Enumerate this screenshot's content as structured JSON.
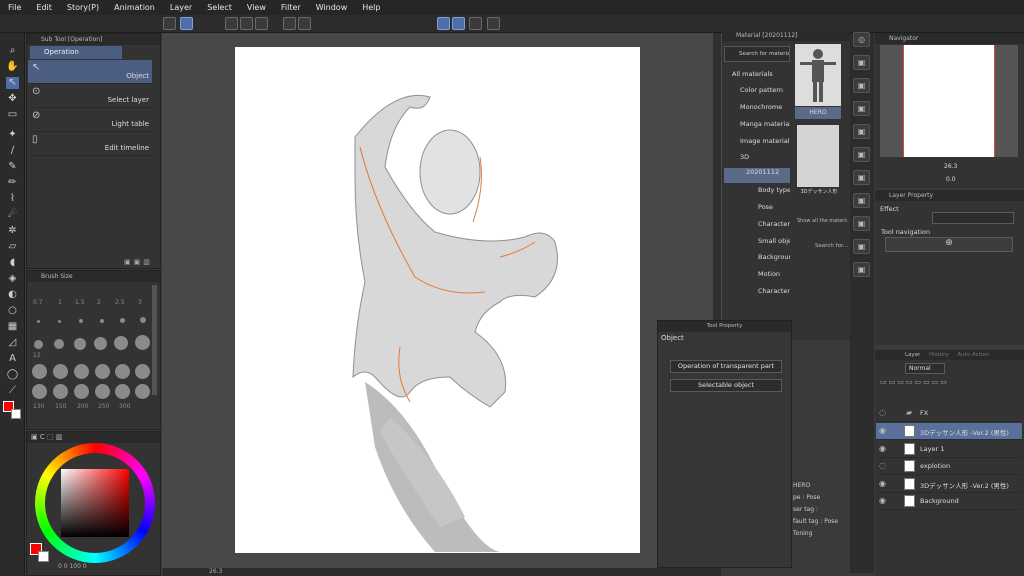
{
  "menu": [
    "File",
    "Edit",
    "Story(P)",
    "Animation",
    "Layer",
    "Select",
    "View",
    "Filter",
    "Window",
    "Help"
  ],
  "subtool": {
    "header": "Sub Tool [Operation]",
    "tab": "Operation",
    "items": [
      "Object",
      "Select layer",
      "Light table",
      "Edit timeline"
    ]
  },
  "brush": {
    "header": "Brush Size",
    "labels": [
      "0.7",
      "1",
      "1.5",
      "2",
      "2.5",
      "3",
      "12",
      "130",
      "150",
      "200",
      "250",
      "300"
    ]
  },
  "color": {
    "primary": "#ff0000",
    "secondary": "#ffffff",
    "bottom_values": "0  0  100  0"
  },
  "canvas": {
    "zoom": "26.3"
  },
  "material": {
    "header": "Material [20201112]",
    "search": "Search for materials",
    "tree": [
      "All materials",
      "Color pattern",
      "Monochrome",
      "Manga material",
      "Image material",
      "3D",
      "20201112",
      "Body type",
      "Pose",
      "Character",
      "Small objects",
      "Background",
      "Motion",
      "Character"
    ],
    "thumb1": "HERO",
    "thumb2": "3Dデッサン人形",
    "show_all": "Show all the materials",
    "search_web": "Search for...",
    "detail_title": "HERO",
    "detail_type": "pe : Pose",
    "detail_tag": "ser tag :",
    "detail_default": "fault tag : Pose",
    "detail_toning": "Toning"
  },
  "toolprop": {
    "header": "Tool Property",
    "section": "Object",
    "dropdown1": "Operation of transparent part",
    "dropdown2": "Selectable object"
  },
  "navigator": {
    "header": "Navigator",
    "zoom": "26.3",
    "rotate": "0.0"
  },
  "layer_property": {
    "header": "Layer Property",
    "effect": "Effect",
    "tool_nav": "Tool navigation"
  },
  "layers": {
    "tabs": [
      "Layer",
      "History",
      "Auto Action"
    ],
    "blend": "Normal",
    "rows": [
      {
        "name": "FX",
        "type": "folder"
      },
      {
        "name": "3Dデッサン人形 -Ver.2 (男性)",
        "type": "3d"
      },
      {
        "name": "Layer 1",
        "type": "raster"
      },
      {
        "name": "explotion",
        "type": "raster"
      },
      {
        "name": "3Dデッサン人形 -Ver.2 (男性)",
        "type": "3d"
      },
      {
        "name": "Background",
        "type": "paper"
      }
    ]
  }
}
